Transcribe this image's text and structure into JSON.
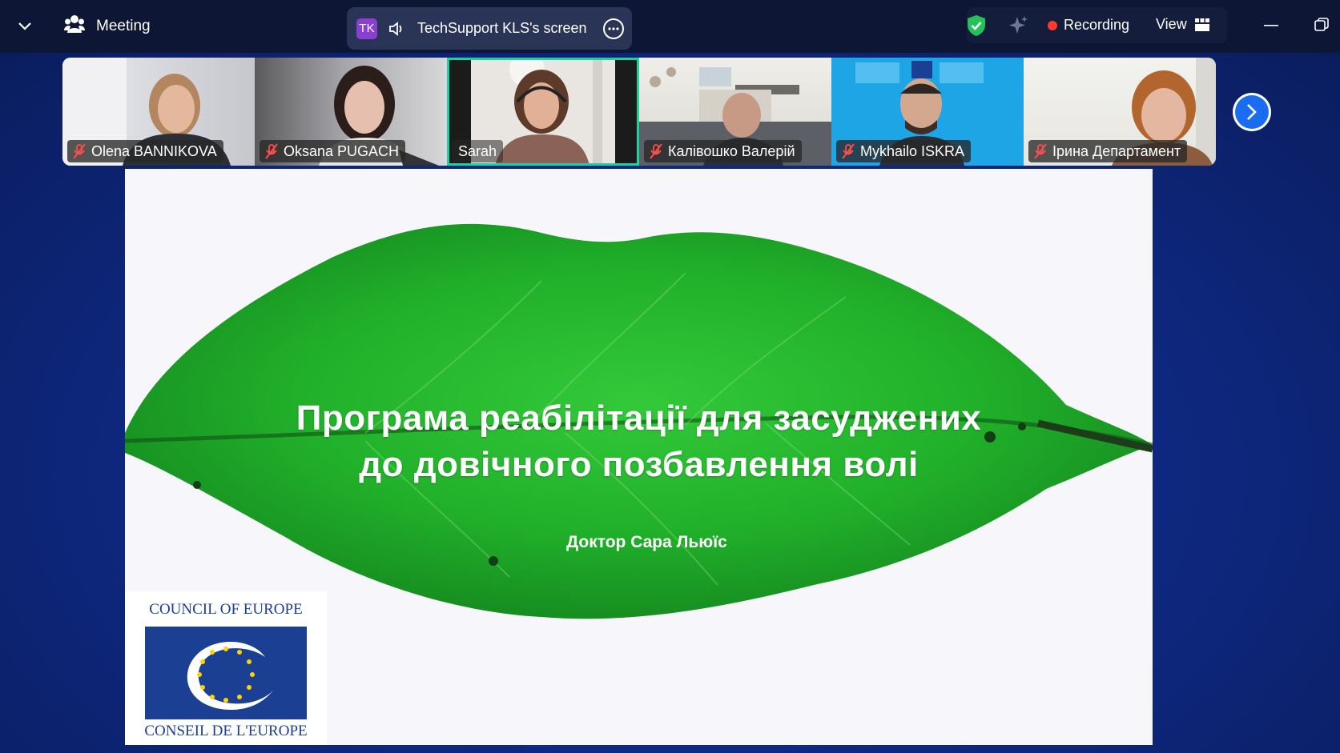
{
  "topbar": {
    "meeting_label": "Meeting",
    "share_initials": "TK",
    "share_label": "TechSupport KLS's screen",
    "recording_label": "Recording",
    "view_label": "View"
  },
  "participants": [
    {
      "name": "Olena BANNIKOVA",
      "muted": true
    },
    {
      "name": "Oksana PUGACH",
      "muted": true
    },
    {
      "name": "Sarah",
      "muted": false,
      "active": true
    },
    {
      "name": "Калівошко Валерій",
      "muted": true
    },
    {
      "name": "Mykhailo ISKRA",
      "muted": true
    },
    {
      "name": "Ірина Департамент",
      "muted": true
    }
  ],
  "slide": {
    "title_line1": "Програма реабілітації для засуджених",
    "title_line2": "до довічного позбавлення волі",
    "author": "Доктор Сара Льюїс",
    "logo_top": "COUNCIL OF EUROPE",
    "logo_bottom": "CONSEIL DE L'EUROPE"
  },
  "colors": {
    "accent": "#1a6cf0",
    "active_speaker": "#20d0a0",
    "recording": "#ff3b30",
    "leaf": "#1fb52a"
  }
}
